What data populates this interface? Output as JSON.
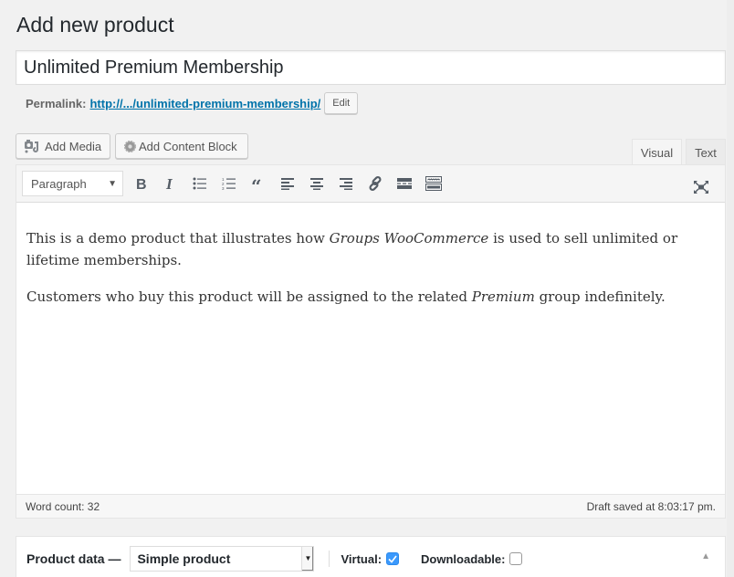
{
  "page": {
    "title": "Add new product"
  },
  "post": {
    "title_value": "Unlimited Premium Membership",
    "permalink_label": "Permalink:",
    "permalink_url": "http://.../unlimited-premium-membership/",
    "permalink_edit_label": "Edit"
  },
  "media_buttons": {
    "add_media": "Add Media",
    "add_content_block": "Add Content Block"
  },
  "editor_tabs": {
    "visual": "Visual",
    "text": "Text",
    "active": "visual"
  },
  "toolbar": {
    "format_selected": "Paragraph",
    "buttons": [
      "bold-icon",
      "italic-icon",
      "bulleted-list-icon",
      "numbered-list-icon",
      "blockquote-icon",
      "align-left-icon",
      "align-center-icon",
      "align-right-icon",
      "link-icon",
      "read-more-icon",
      "toolbar-toggle-icon"
    ],
    "fullscreen": "fullscreen-icon"
  },
  "content": {
    "p1_a": "This is a demo product that illustrates how ",
    "p1_em": "Groups WooCommerce",
    "p1_b": " is used to sell unlimited or lifetime memberships.",
    "p2_a": "Customers who buy this product will be assigned to the related ",
    "p2_em": "Premium",
    "p2_b": " group indefinitely."
  },
  "status": {
    "word_count": "Word count: 32",
    "draft_saved": "Draft saved at 8:03:17 pm."
  },
  "product_data": {
    "label": "Product data —",
    "type_selected": "Simple product",
    "virtual_label": "Virtual:",
    "virtual_checked": true,
    "downloadable_label": "Downloadable:",
    "downloadable_checked": false
  },
  "colors": {
    "link": "#0073aa",
    "checkbox_checked": "#3b99fc",
    "background": "#f1f1f1"
  }
}
